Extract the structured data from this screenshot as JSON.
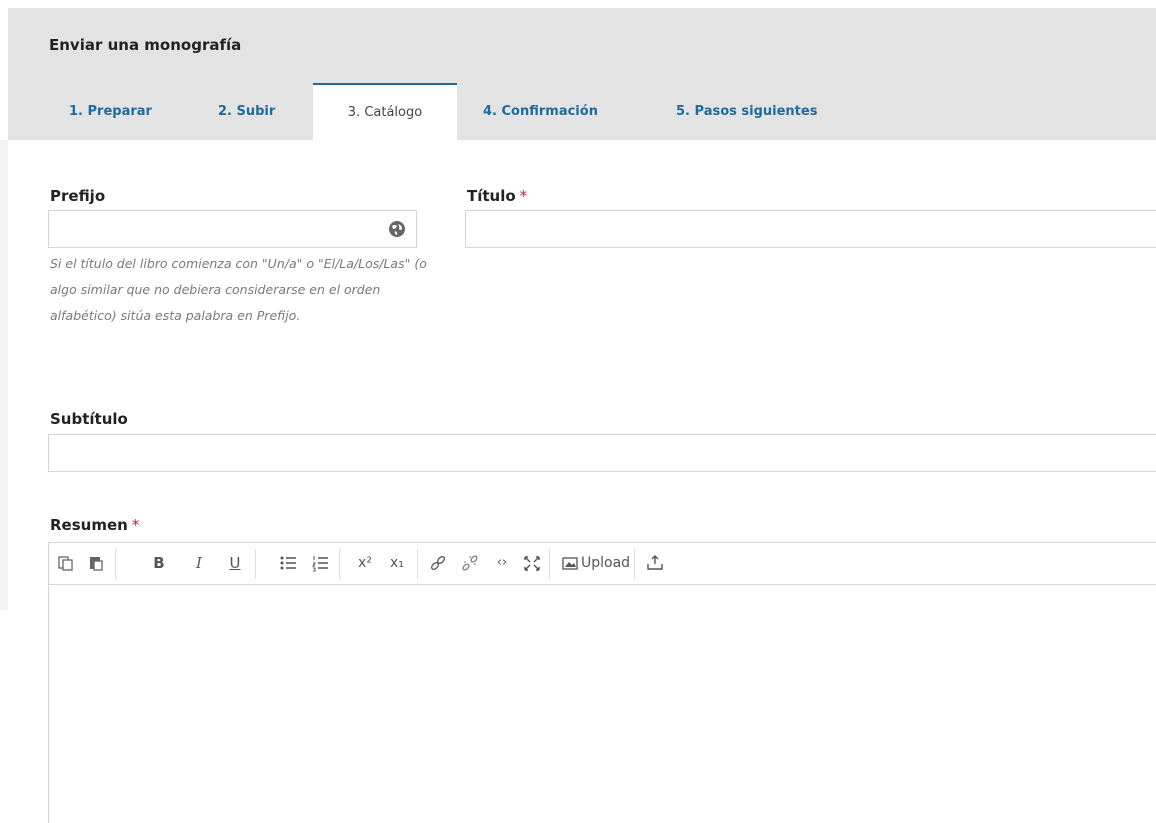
{
  "header": {
    "title": "Enviar una monografía",
    "tabs": [
      {
        "label": "1. Preparar",
        "active": false
      },
      {
        "label": "2. Subir",
        "active": false
      },
      {
        "label": "3. Catálogo",
        "active": true
      },
      {
        "label": "4. Confirmación",
        "active": false
      },
      {
        "label": "5. Pasos siguientes",
        "active": false
      }
    ]
  },
  "form": {
    "prefix": {
      "label": "Prefijo",
      "value": "",
      "help": "Si el título del libro comienza con \"Un/a\" o \"El/La/Los/Las\" (o algo similar que no debiera considerarse en el orden alfabético) sitúa esta palabra en Prefijo."
    },
    "title": {
      "label": "Título",
      "required_mark": "*",
      "value": ""
    },
    "subtitle": {
      "label": "Subtítulo",
      "value": ""
    },
    "abstract": {
      "label": "Resumen",
      "required_mark": "*",
      "toolbar": {
        "upload_label": "Upload",
        "icons": [
          "copy-icon",
          "paste-icon",
          "bold-icon",
          "italic-icon",
          "underline-icon",
          "bullet-list-icon",
          "numbered-list-icon",
          "superscript-icon",
          "subscript-icon",
          "link-icon",
          "unlink-icon",
          "code-icon",
          "fullscreen-icon",
          "image-icon",
          "upload-icon"
        ]
      },
      "value": ""
    }
  },
  "colors": {
    "link": "#1e6b9e",
    "required": "#c0223b",
    "header_bg": "#e3e3e3"
  }
}
